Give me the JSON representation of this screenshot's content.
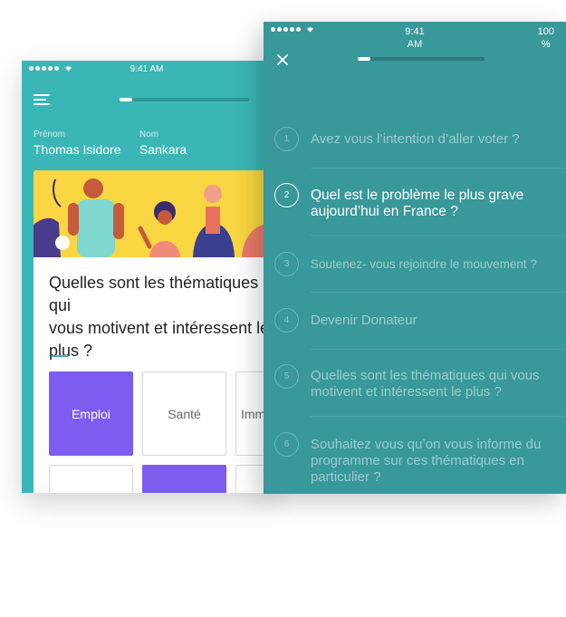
{
  "back_screen": {
    "status_time": "9:41 AM",
    "first_name_label": "Prénom",
    "first_name_value": "Thomas Isidore",
    "last_name_label": "Nom",
    "last_name_value": "Sankara",
    "progress_fraction": 0.1,
    "question": "Quelles sont les thématiques qui\nvous motivent et intéressent le\nplus ?",
    "options": [
      {
        "label": "Emploi",
        "selected": true
      },
      {
        "label": "Santé",
        "selected": false
      },
      {
        "label": "Immigration",
        "selected": false
      },
      {
        "label": "",
        "selected": false
      },
      {
        "label": "",
        "selected": true
      },
      {
        "label": "",
        "selected": false
      }
    ],
    "colors": {
      "teal": "#3bb6b6",
      "accent": "#7d5cf0",
      "illustration_bg": "#f9d642"
    }
  },
  "front_screen": {
    "status_time_line1": "9:41",
    "status_time_line2": "AM",
    "battery_line1": "100",
    "battery_line2": "%",
    "progress_fraction": 0.1,
    "steps": [
      {
        "number": "1",
        "text": "Avez vous l’intention d’aller voter ?"
      },
      {
        "number": "2",
        "text": "Quel est le problème le plus grave\naujourd’hui  en France ?"
      },
      {
        "number": "3",
        "text": "Soutenez- vous rejoindre le mouvement ?"
      },
      {
        "number": "4",
        "text": "Devenir Donateur"
      },
      {
        "number": "5",
        "text": "Quelles sont les thématiques qui vous\nmotivent et intéressent le plus ?"
      },
      {
        "number": "6",
        "text": "Souhaitez vous qu’on vous informe du\nprogramme sur ces thématiques en\nparticulier ?"
      }
    ],
    "active_step": "2",
    "colors": {
      "teal_dark": "#38989a"
    }
  }
}
